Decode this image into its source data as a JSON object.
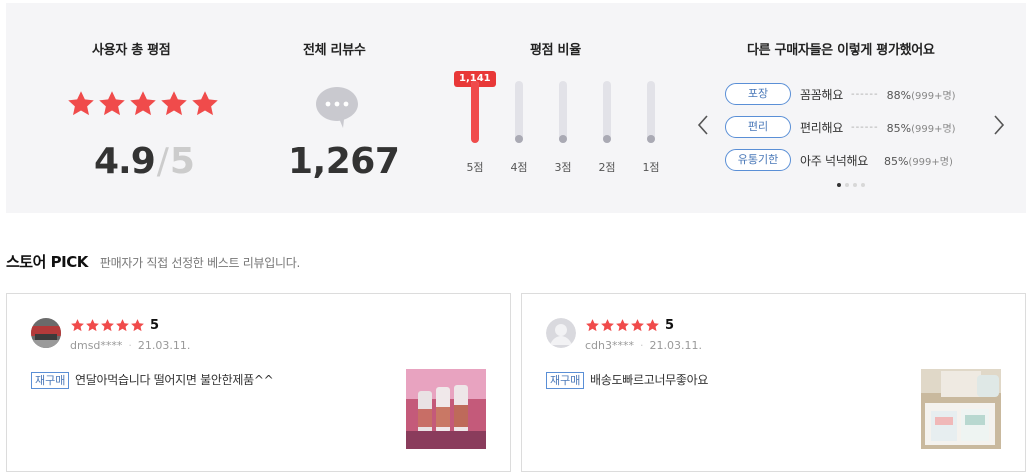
{
  "summary": {
    "rating_title": "사용자 총 평점",
    "total_title": "전체 리뷰수",
    "ratio_title": "평점 비율",
    "others_title": "다른 구매자들은 이렇게 평가했어요",
    "score": "4.9",
    "score_slash": "/",
    "score_max": "5",
    "rating_value": 4.9,
    "total_reviews": "1,267",
    "ratio": {
      "highlight_count": "1,141",
      "bars": [
        {
          "label": "5점",
          "fraction": 1.0,
          "active": true
        },
        {
          "label": "4점",
          "fraction": 0.1,
          "active": false
        },
        {
          "label": "3점",
          "fraction": 0.1,
          "active": false
        },
        {
          "label": "2점",
          "fraction": 0.0,
          "active": false
        },
        {
          "label": "1점",
          "fraction": 0.0,
          "active": false
        }
      ]
    },
    "others": {
      "rows": [
        {
          "tag": "포장",
          "text": "꼼꼼해요",
          "dots": "------",
          "pct": "88%",
          "count": "(999+명)"
        },
        {
          "tag": "편리",
          "text": "편리해요",
          "dots": "------",
          "pct": "85%",
          "count": "(999+명)"
        },
        {
          "tag": "유통기한",
          "text": "아주 넉넉해요",
          "dots": "",
          "pct": "85%",
          "count": "(999+명)"
        }
      ],
      "pager_total": 4,
      "pager_active": 0
    }
  },
  "pick": {
    "title_prefix": "스토어",
    "title_suffix": "PICK",
    "subtitle": "판매자가 직접 선정한 베스트 리뷰입니다."
  },
  "reviews": [
    {
      "rating": "5",
      "user": "dmsd****",
      "date": "21.03.11.",
      "badge": "재구매",
      "text": "연달아먹습니다 떨어지면 불안한제품^^"
    },
    {
      "rating": "5",
      "user": "cdh3****",
      "date": "21.03.11.",
      "badge": "재구매",
      "text": "배송도빠르고너무좋아요"
    }
  ],
  "colors": {
    "star": "#f04b4b",
    "accent_blue": "#4a78b8",
    "panel_bg": "#f5f5f7"
  },
  "icons": {
    "star": "star-icon",
    "bubble": "speech-bubble-icon",
    "prev": "chevron-left-icon",
    "next": "chevron-right-icon"
  }
}
